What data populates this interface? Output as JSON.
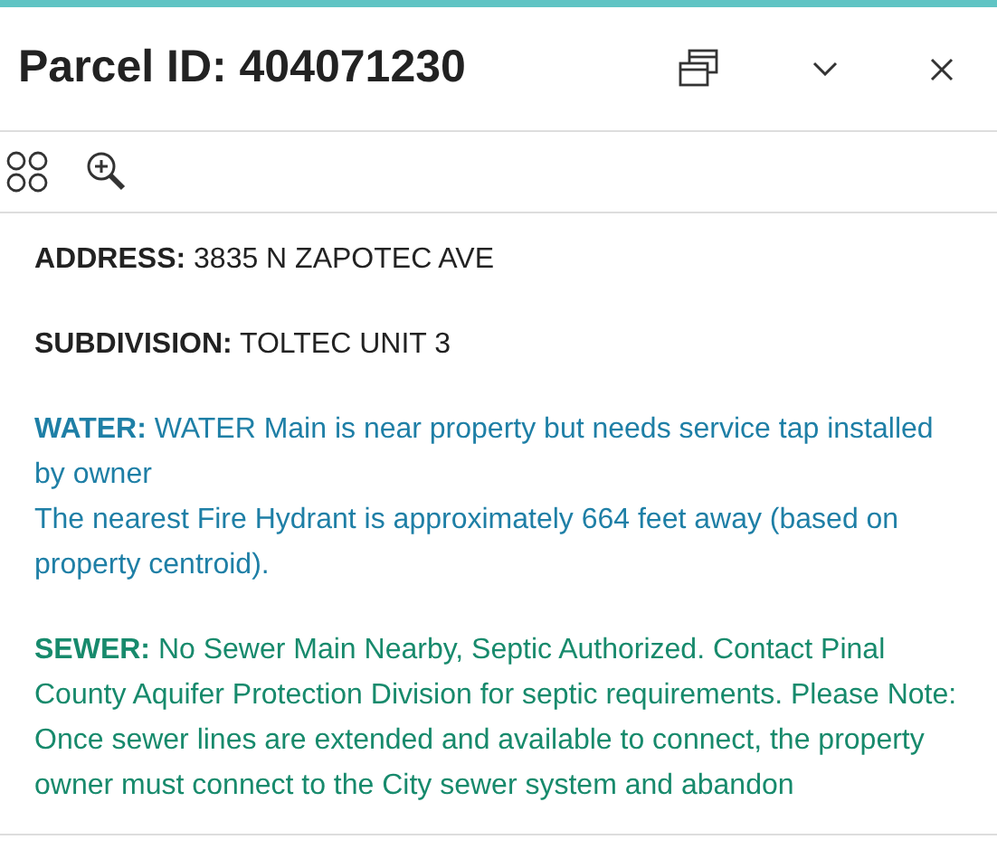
{
  "panel": {
    "title": "Parcel ID: 404071230"
  },
  "sections": [
    {
      "label": "ADDRESS:",
      "color": "#222222",
      "paragraphs": [
        " 3835 N ZAPOTEC AVE"
      ]
    },
    {
      "label": "SUBDIVISION:",
      "color": "#222222",
      "paragraphs": [
        "TOLTEC UNIT 3"
      ]
    },
    {
      "label": "WATER:",
      "color": "#1e7fa6",
      "paragraphs": [
        "WATER Main is near property but needs service tap installed by owner",
        "The nearest Fire Hydrant is approximately 664 feet away (based on property centroid)."
      ]
    },
    {
      "label": "SEWER:",
      "color": "#178a6c",
      "paragraphs": [
        "No Sewer Main Nearby, Septic Authorized. Contact Pinal County Aquifer Protection Division for septic requirements. Please Note: Once sewer lines are extended and available to connect, the property owner must connect to the City sewer system and abandon"
      ]
    }
  ]
}
